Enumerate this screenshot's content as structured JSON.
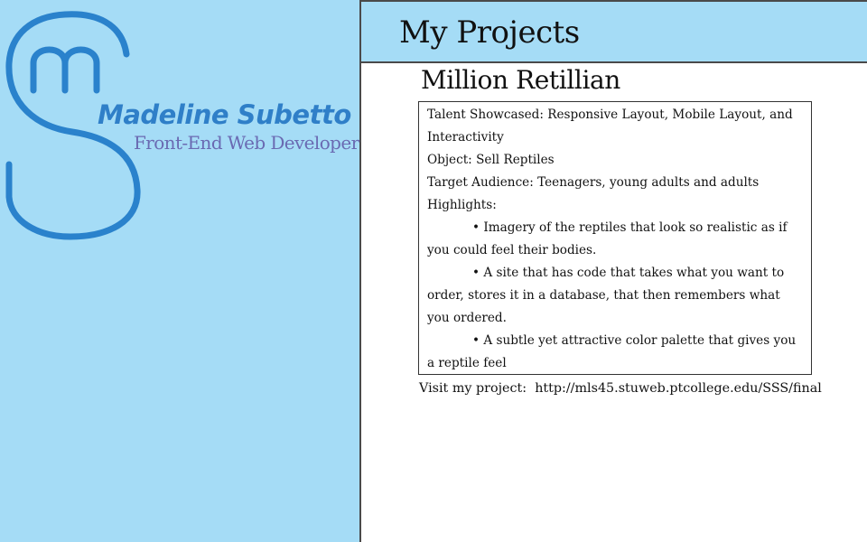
{
  "brand": {
    "name": "Madeline Subetto",
    "title": "Front-End Web Developer",
    "logo_icon": "sm-monogram-icon",
    "colors": {
      "logo": "#2a82cc",
      "name": "#2f7fc8",
      "title": "#6a6ab2",
      "panel": "#a5dcf6"
    }
  },
  "header": {
    "title": "My Projects"
  },
  "project": {
    "name": "Million Retillian",
    "talent": "Talent Showcased: Responsive Layout, Mobile Layout, and Interactivity",
    "object": "Object: Sell Reptiles",
    "audience": "Target Audience: Teenagers, young adults and adults",
    "highlights_label": "Highlights:",
    "highlights": [
      "• Imagery of the reptiles that look so realistic as if you could feel their bodies.",
      "• A site that has code that takes what you want to order, stores it in a database, that then remembers what you ordered.",
      "• A subtle yet attractive color palette that gives you a reptile feel"
    ],
    "visit_label": "Visit my project:",
    "visit_url": "http://mls45.stuweb.ptcollege.edu/SSS/final"
  }
}
